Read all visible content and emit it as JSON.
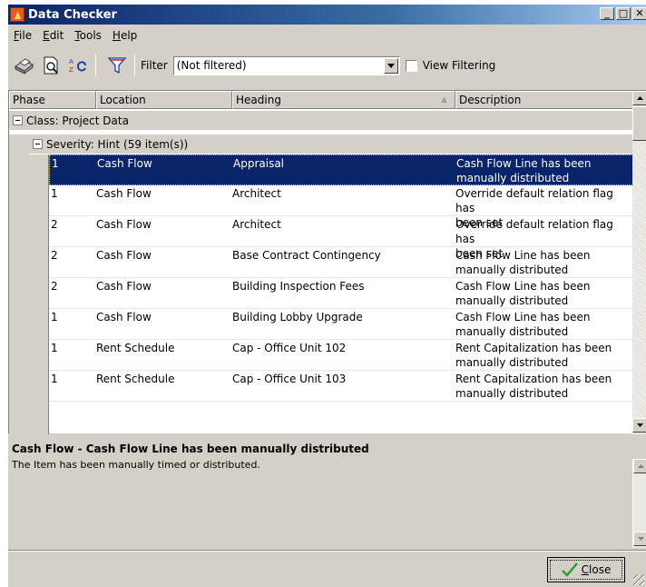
{
  "window": {
    "title": "Data Checker"
  },
  "title_buttons": {
    "minimize": "_",
    "maximize": "□",
    "close": "✕"
  },
  "menu": [
    {
      "label": "File",
      "mnemonic": "F",
      "rest": "ile"
    },
    {
      "label": "Edit",
      "mnemonic": "E",
      "rest": "dit"
    },
    {
      "label": "Tools",
      "mnemonic": "T",
      "rest": "ools"
    },
    {
      "label": "Help",
      "mnemonic": "H",
      "rest": "elp"
    }
  ],
  "toolbar": {
    "icons": [
      "print-icon",
      "print-preview-icon",
      "sort-icon",
      "filter-icon"
    ],
    "filter_label": "Filter",
    "filter_value": "(Not filtered)",
    "view_filtering_label": "View Filtering",
    "view_filtering_checked": false
  },
  "grid": {
    "columns": [
      "Phase",
      "Location",
      "Heading",
      "Description"
    ],
    "sort_glyph": "▲",
    "group_class": "Class: Project Data",
    "group_severity": "Severity: Hint (59 item(s))",
    "rows": [
      {
        "phase": "1",
        "location": "Cash Flow",
        "heading": "Appraisal",
        "desc1": "Cash Flow Line has been",
        "desc2": "manually distributed",
        "selected": true
      },
      {
        "phase": "1",
        "location": "Cash Flow",
        "heading": "Architect",
        "desc1": "Override default relation flag has",
        "desc2": "been set",
        "selected": false
      },
      {
        "phase": "2",
        "location": "Cash Flow",
        "heading": "Architect",
        "desc1": "Override default relation flag has",
        "desc2": "been set",
        "selected": false
      },
      {
        "phase": "2",
        "location": "Cash Flow",
        "heading": "Base Contract Contingency",
        "desc1": "Cash Flow Line has been",
        "desc2": "manually distributed",
        "selected": false
      },
      {
        "phase": "2",
        "location": "Cash Flow",
        "heading": "Building Inspection Fees",
        "desc1": "Cash Flow Line has been",
        "desc2": "manually distributed",
        "selected": false
      },
      {
        "phase": "1",
        "location": "Cash Flow",
        "heading": "Building Lobby Upgrade",
        "desc1": "Cash Flow Line has been",
        "desc2": "manually distributed",
        "selected": false
      },
      {
        "phase": "1",
        "location": "Rent Schedule",
        "heading": "Cap - Office Unit 102",
        "desc1": "Rent Capitalization has been",
        "desc2": "manually distributed",
        "selected": false
      },
      {
        "phase": "1",
        "location": "Rent Schedule",
        "heading": "Cap - Office Unit 103",
        "desc1": "Rent Capitalization has been",
        "desc2": "manually distributed",
        "selected": false
      }
    ]
  },
  "detail": {
    "title": "Cash Flow - Cash Flow Line has been manually distributed",
    "text": "The Item has been manually timed or distributed."
  },
  "close_button": {
    "mnemonic": "C",
    "rest": "lose"
  },
  "colors": {
    "selection": "#0a246a",
    "face": "#d4d0c8",
    "title_start": "#0a246a",
    "check_green": "#2e9e2e"
  }
}
